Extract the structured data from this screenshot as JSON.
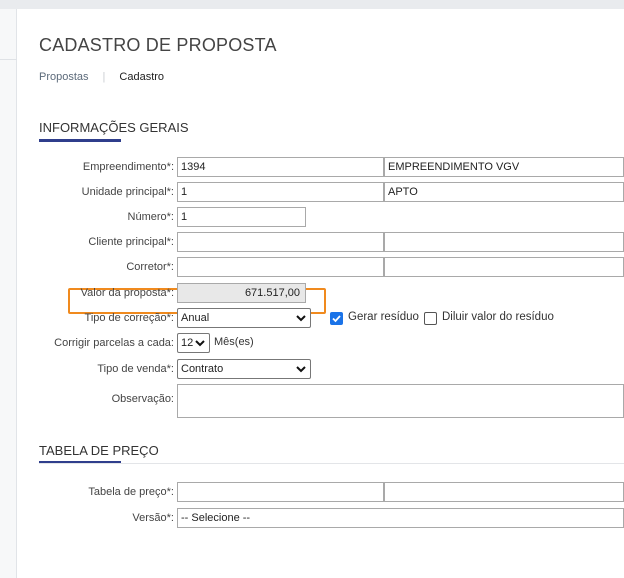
{
  "page": {
    "title": "CADASTRO DE PROPOSTA",
    "breadcrumb": {
      "link": "Propostas",
      "current": "Cadastro"
    }
  },
  "sections": {
    "general": "INFORMAÇÕES GERAIS",
    "price_table": "TABELA DE PREÇO"
  },
  "form": {
    "empreendimento": {
      "label": "Empreendimento*:",
      "code": "1394",
      "name": "EMPREENDIMENTO VGV"
    },
    "unidade": {
      "label": "Unidade principal*:",
      "code": "1",
      "name": "APTO"
    },
    "numero": {
      "label": "Número*:",
      "value": "1"
    },
    "cliente": {
      "label": "Cliente principal*:",
      "code": "",
      "name": ""
    },
    "corretor": {
      "label": "Corretor*:",
      "code": "",
      "name": ""
    },
    "valor": {
      "label": "Valor da proposta*:",
      "value": "671.517,00"
    },
    "tipo_correcao": {
      "label": "Tipo de correção*:",
      "selected": "Anual"
    },
    "gerar_residuo": {
      "label": "Gerar resíduo",
      "checked": true
    },
    "diluir_residuo": {
      "label": "Diluir valor do resíduo",
      "checked": false
    },
    "corrigir": {
      "label": "Corrigir parcelas a cada:",
      "selected": "12",
      "unit": "Mês(es)"
    },
    "tipo_venda": {
      "label": "Tipo de venda*:",
      "selected": "Contrato"
    },
    "observacao": {
      "label": "Observação:",
      "value": ""
    },
    "tabela_preco": {
      "label": "Tabela de preço*:",
      "code": "",
      "name": ""
    },
    "versao": {
      "label": "Versão*:",
      "selected": "-- Selecione --"
    }
  },
  "colors": {
    "accent": "#2f3e8c",
    "highlight": "#f08a1e",
    "checkbox": "#1a73e8"
  }
}
